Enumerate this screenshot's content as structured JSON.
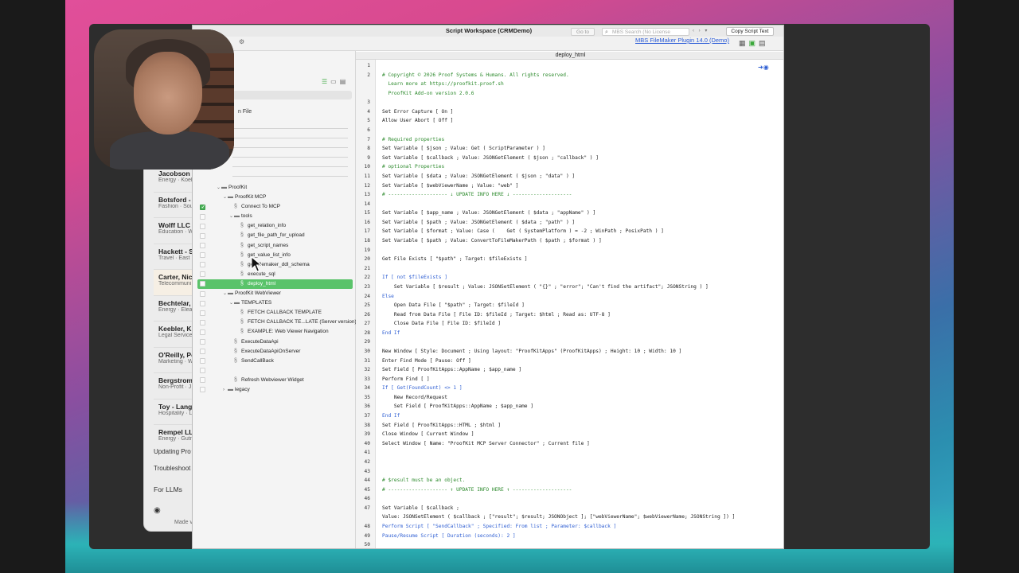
{
  "window": {
    "title": "Script Workspace (CRMDemo)",
    "goto_label": "Go to",
    "search_placeholder": "MBS Search (No License",
    "copy_button": "Copy Script Text",
    "plugin_link": "MBS FileMaker Plugin 14.0 (Demo)",
    "active_tab": "deploy_html"
  },
  "left_pane": {
    "new_file_label": "n File",
    "tree": [
      {
        "label": "ProofKit",
        "level": 0,
        "kind": "folder",
        "expanded": true,
        "checked": false
      },
      {
        "label": "ProofKit MCP",
        "level": 1,
        "kind": "folder",
        "expanded": true,
        "checked": false
      },
      {
        "label": "Connect To MCP",
        "level": 2,
        "kind": "script",
        "checked": true
      },
      {
        "label": "tools",
        "level": 2,
        "kind": "folder",
        "expanded": true,
        "checked": false
      },
      {
        "label": "get_relation_info",
        "level": 3,
        "kind": "script",
        "checked": false
      },
      {
        "label": "get_file_path_for_upload",
        "level": 3,
        "kind": "script",
        "checked": false
      },
      {
        "label": "get_script_names",
        "level": 3,
        "kind": "script",
        "checked": false
      },
      {
        "label": "get_value_list_info",
        "level": 3,
        "kind": "script",
        "checked": false
      },
      {
        "label": "get_filemaker_ddl_schema",
        "level": 3,
        "kind": "script",
        "checked": false
      },
      {
        "label": "execute_sql",
        "level": 3,
        "kind": "script",
        "checked": false
      },
      {
        "label": "deploy_html",
        "level": 3,
        "kind": "script",
        "checked": false,
        "selected": true
      },
      {
        "label": "ProofKit WebViewer",
        "level": 1,
        "kind": "folder",
        "expanded": true,
        "checked": false
      },
      {
        "label": "TEMPLATES",
        "level": 2,
        "kind": "folder",
        "expanded": true,
        "checked": false
      },
      {
        "label": "FETCH CALLBACK TEMPLATE",
        "level": 3,
        "kind": "script",
        "checked": false
      },
      {
        "label": "FETCH CALLBACK TE...LATE (Server version)",
        "level": 3,
        "kind": "script",
        "checked": false
      },
      {
        "label": "EXAMPLE: Web Viewer Navigation",
        "level": 3,
        "kind": "script",
        "checked": false
      },
      {
        "label": "ExecuteDataApi",
        "level": 2,
        "kind": "script",
        "checked": false
      },
      {
        "label": "ExecuteDataApiOnServer",
        "level": 2,
        "kind": "script",
        "checked": false
      },
      {
        "label": "SendCallBack",
        "level": 2,
        "kind": "script",
        "checked": false
      },
      {
        "label": "",
        "level": 2,
        "kind": "blank",
        "checked": false
      },
      {
        "label": "Refresh Webviewer Widget",
        "level": 2,
        "kind": "script",
        "checked": false
      },
      {
        "label": "legacy",
        "level": 1,
        "kind": "folder",
        "expanded": false,
        "checked": false
      }
    ]
  },
  "editor": {
    "lines": [
      {
        "n": "1",
        "t": "",
        "c": ""
      },
      {
        "n": "2",
        "t": "# Copyright © 2026 Proof Systems & Humans. All rights reserved.",
        "c": "cm"
      },
      {
        "n": "",
        "t": "  Learn more at https://proofkit.proof.sh",
        "c": "cm"
      },
      {
        "n": "",
        "t": "  ProofKit Add-on version 2.0.6",
        "c": "cm"
      },
      {
        "n": "3",
        "t": "",
        "c": ""
      },
      {
        "n": "4",
        "t": "Set Error Capture [ On ]",
        "c": ""
      },
      {
        "n": "5",
        "t": "Allow User Abort [ Off ]",
        "c": ""
      },
      {
        "n": "6",
        "t": "",
        "c": ""
      },
      {
        "n": "7",
        "t": "# Required properties",
        "c": "cm"
      },
      {
        "n": "8",
        "t": "Set Variable [ $json ; Value: Get ( ScriptParameter ) ]",
        "c": ""
      },
      {
        "n": "9",
        "t": "Set Variable [ $callback ; Value: JSONGetElement ( $json ; \"callback\" ) ]",
        "c": ""
      },
      {
        "n": "10",
        "t": "# optional Properties",
        "c": "cm"
      },
      {
        "n": "11",
        "t": "Set Variable [ $data ; Value: JSONGetElement ( $json ; \"data\" ) ]",
        "c": ""
      },
      {
        "n": "12",
        "t": "Set Variable [ $webViewerName ; Value: \"web\" ]",
        "c": ""
      },
      {
        "n": "13",
        "t": "# -------------------- ↓ UPDATE INFO HERE ↓ --------------------",
        "c": "cm"
      },
      {
        "n": "14",
        "t": "",
        "c": ""
      },
      {
        "n": "15",
        "t": "Set Variable [ $app_name ; Value: JSONGetElement ( $data ; \"appName\" ) ]",
        "c": ""
      },
      {
        "n": "16",
        "t": "Set Variable [ $path ; Value: JSONGetElement ( $data ; \"path\" ) ]",
        "c": ""
      },
      {
        "n": "17",
        "t": "Set Variable [ $format ; Value: Case (    Get ( SystemPlatform ) = -2 ; WinPath ; PosixPath ) ]",
        "c": ""
      },
      {
        "n": "18",
        "t": "Set Variable [ $path ; Value: ConvertToFileMakerPath ( $path ; $format ) ]",
        "c": ""
      },
      {
        "n": "19",
        "t": "",
        "c": ""
      },
      {
        "n": "20",
        "t": "Get File Exists [ \"$path\" ; Target: $fileExists ]",
        "c": ""
      },
      {
        "n": "21",
        "t": "",
        "c": ""
      },
      {
        "n": "22",
        "t": "If [ not $fileExists ]",
        "c": "kw"
      },
      {
        "n": "23",
        "t": "    Set Variable [ $result ; Value: JSONSetElement ( \"{}\" ; \"error\"; \"Can't find the artifact\"; JSONString ) ]",
        "c": ""
      },
      {
        "n": "24",
        "t": "Else",
        "c": "kw"
      },
      {
        "n": "25",
        "t": "    Open Data File [ \"$path\" ; Target: $fileId ]",
        "c": ""
      },
      {
        "n": "26",
        "t": "    Read from Data File [ File ID: $fileId ; Target: $html ; Read as: UTF-8 ]",
        "c": ""
      },
      {
        "n": "27",
        "t": "    Close Data File [ File ID: $fileId ]",
        "c": ""
      },
      {
        "n": "28",
        "t": "End If",
        "c": "kw"
      },
      {
        "n": "29",
        "t": "",
        "c": ""
      },
      {
        "n": "30",
        "t": "New Window [ Style: Document ; Using layout: \"ProofKitApps\" (ProofKitApps) ; Height: 10 ; Width: 10 ]",
        "c": ""
      },
      {
        "n": "31",
        "t": "Enter Find Mode [ Pause: Off ]",
        "c": ""
      },
      {
        "n": "32",
        "t": "Set Field [ ProofKitApps::AppName ; $app_name ]",
        "c": ""
      },
      {
        "n": "33",
        "t": "Perform Find [ ]",
        "c": ""
      },
      {
        "n": "34",
        "t": "If [ Get(FoundCount) <> 1 ]",
        "c": "kw"
      },
      {
        "n": "35",
        "t": "    New Record/Request",
        "c": ""
      },
      {
        "n": "36",
        "t": "    Set Field [ ProofKitApps::AppName ; $app_name ]",
        "c": ""
      },
      {
        "n": "37",
        "t": "End If",
        "c": "kw"
      },
      {
        "n": "38",
        "t": "Set Field [ ProofKitApps::HTML ; $html ]",
        "c": ""
      },
      {
        "n": "39",
        "t": "Close Window [ Current Window ]",
        "c": ""
      },
      {
        "n": "40",
        "t": "Select Window [ Name: \"ProofKit MCP Server Connector\" ; Current file ]",
        "c": ""
      },
      {
        "n": "41",
        "t": "",
        "c": ""
      },
      {
        "n": "42",
        "t": "",
        "c": ""
      },
      {
        "n": "43",
        "t": "",
        "c": ""
      },
      {
        "n": "44",
        "t": "# $result must be an object.",
        "c": "cm"
      },
      {
        "n": "45",
        "t": "# -------------------- ↑ UPDATE INFO HERE ↑ --------------------",
        "c": "cm"
      },
      {
        "n": "46",
        "t": "",
        "c": ""
      },
      {
        "n": "47",
        "t": "Set Variable [ $callback ;",
        "c": ""
      },
      {
        "n": "",
        "t": "Value: JSONSetElement ( $callback ; [\"result\"; $result; JSONObject ]; [\"webViewerName\"; $webViewerName; JSONString ]) ]",
        "c": ""
      },
      {
        "n": "48",
        "t": "Perform Script [ \"SendCallback\" ; Specified: From list ; Parameter: $callback ]",
        "c": "kw"
      },
      {
        "n": "49",
        "t": "Pause/Resume Script [ Duration (seconds): 2 ]",
        "c": "kw"
      },
      {
        "n": "50",
        "t": "",
        "c": ""
      }
    ]
  },
  "background_app": {
    "contacts": [
      {
        "name": "Jacobson -",
        "sub": "Energy · Koel"
      },
      {
        "name": "Botsford - F",
        "sub": "Fashion · Sou"
      },
      {
        "name": "Wolff LLC",
        "sub": "Education · W"
      },
      {
        "name": "Hackett - S",
        "sub": "Travel · East I"
      },
      {
        "name": "Carter, Nico",
        "sub": "Telecommuni"
      },
      {
        "name": "Bechtelar, C",
        "sub": "Energy · Elea"
      },
      {
        "name": "Keebler, Ku",
        "sub": "Legal Service"
      },
      {
        "name": "O'Reilly, Po",
        "sub": "Marketing · W"
      },
      {
        "name": "Bergstrom -",
        "sub": "Non-Profit · J"
      },
      {
        "name": "Toy - Langv",
        "sub": "Hospitality · L"
      },
      {
        "name": "Rempel LLC",
        "sub": "Energy · Gutn"
      }
    ],
    "nav": [
      "Updating Pro",
      "Troubleshoot"
    ],
    "for_llms": "For LLMs",
    "made": "Made v"
  }
}
